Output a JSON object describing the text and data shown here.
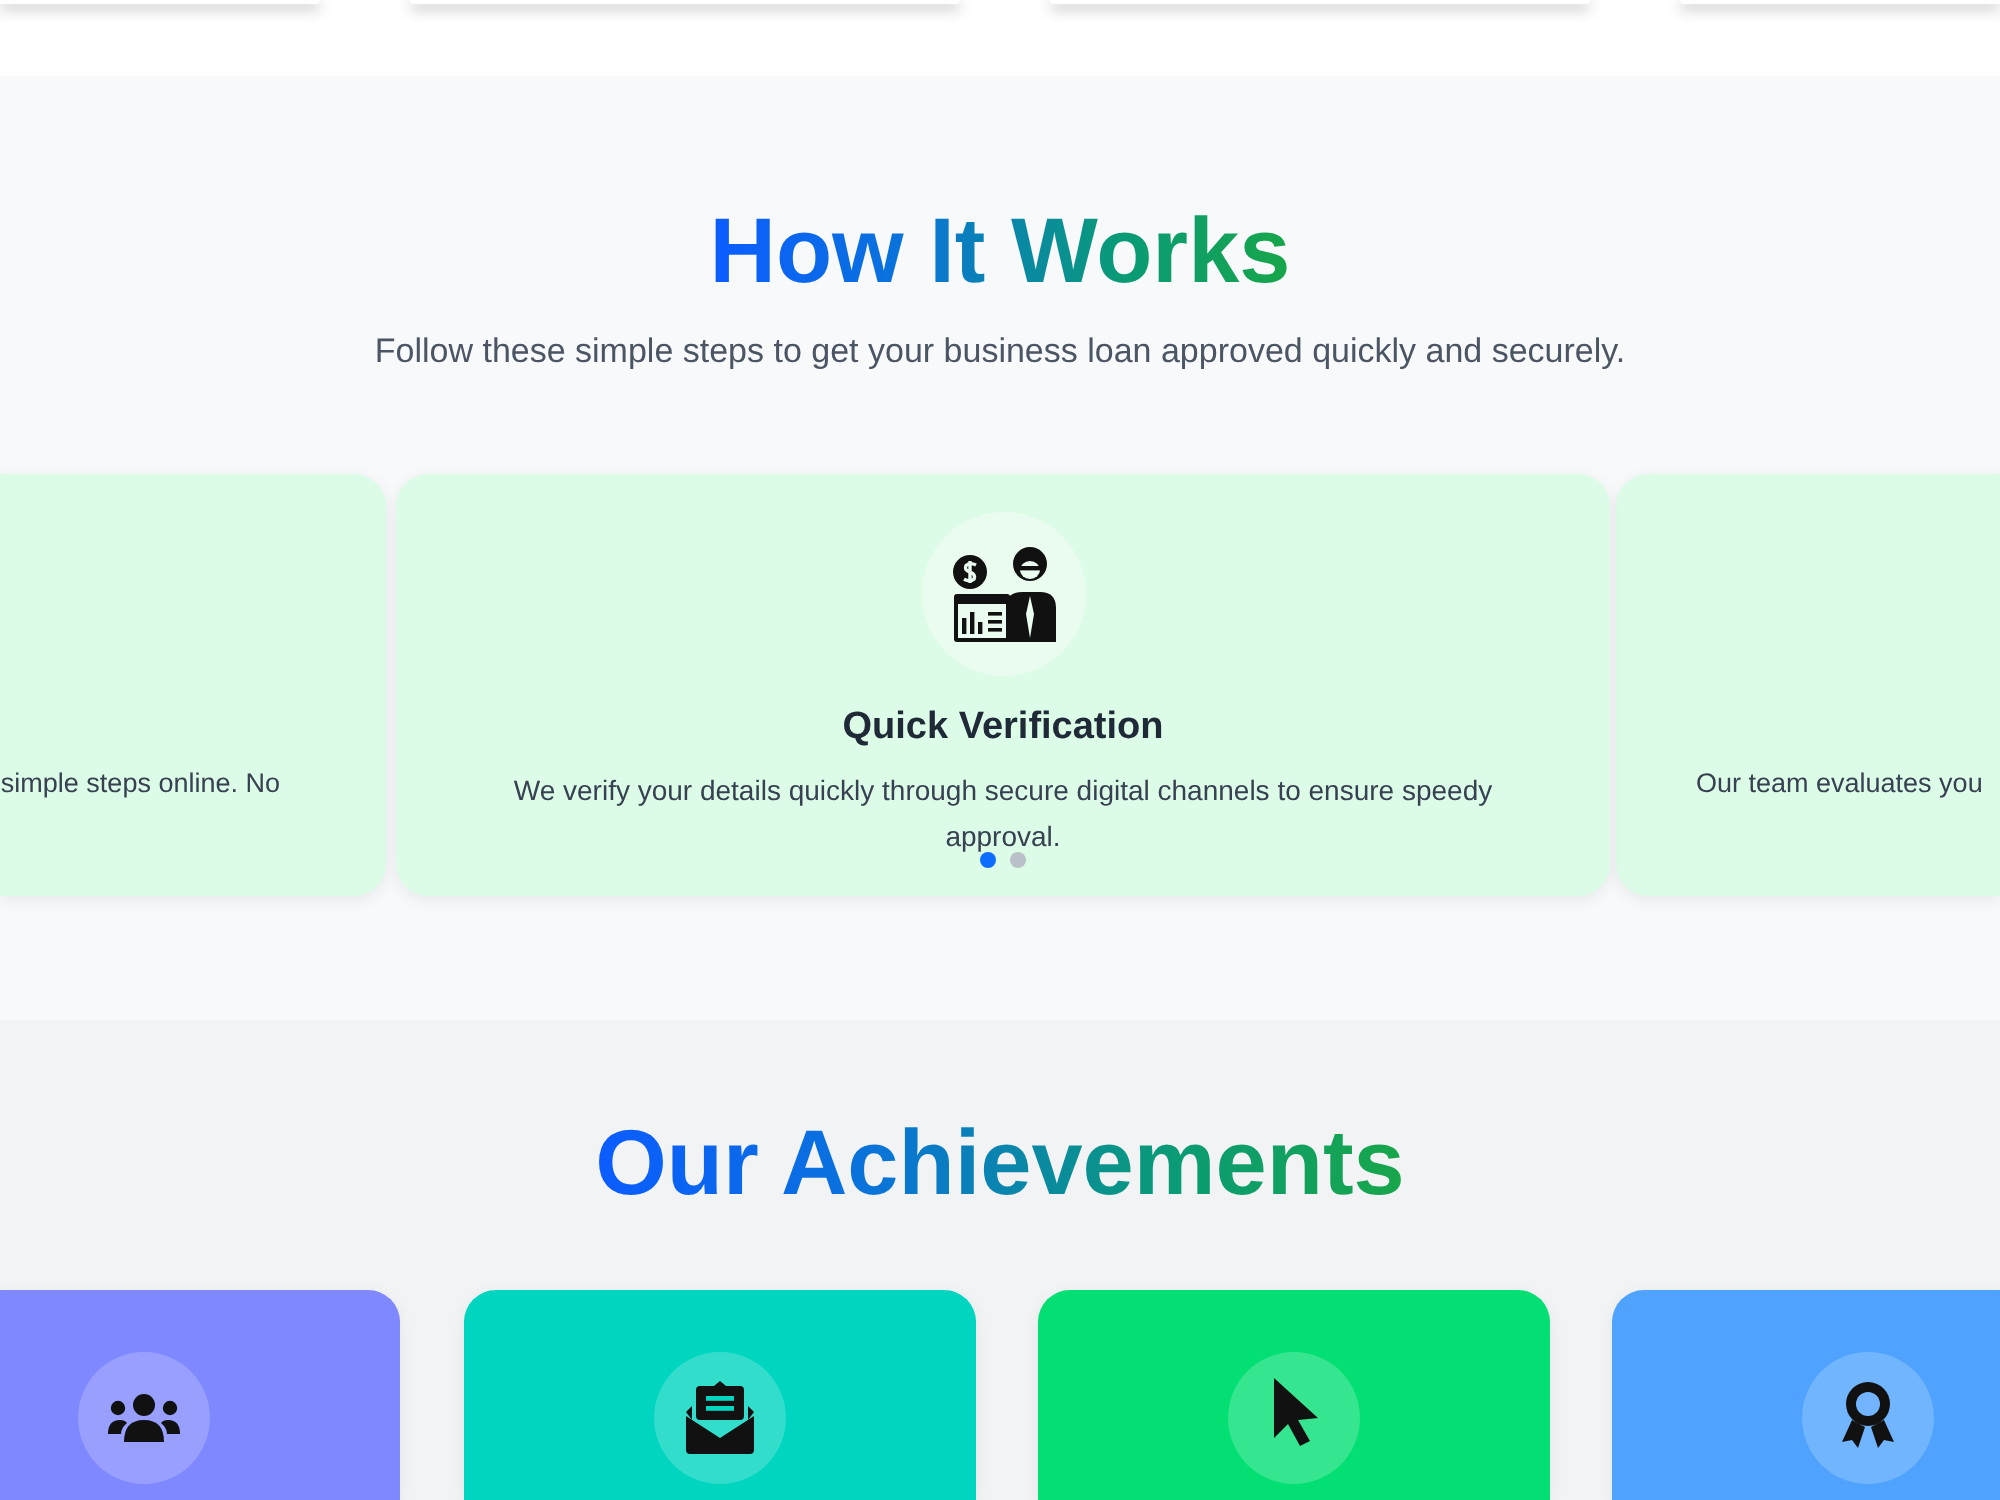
{
  "how_it_works": {
    "title": "How It Works",
    "subtitle": "Follow these simple steps to get your business loan approved quickly and securely.",
    "slides": [
      {
        "description": "simple steps online. No",
        "selected": false
      },
      {
        "kind": "verification",
        "title": "Quick Verification",
        "description": "We verify your details quickly through secure digital channels to ensure speedy approval.",
        "selected": true
      },
      {
        "description": "Our team evaluates you",
        "selected": false
      }
    ],
    "indicators": [
      {
        "selected": true
      },
      {
        "selected": false
      }
    ]
  },
  "achievements": {
    "title": "Our Achievements",
    "cards": [
      {
        "kind": "users",
        "color": "#7f88ff"
      },
      {
        "kind": "envelope",
        "color": "#00d5c0"
      },
      {
        "kind": "cursor",
        "color": "#03df73"
      },
      {
        "kind": "award",
        "color": "#4fa3ff"
      }
    ]
  }
}
